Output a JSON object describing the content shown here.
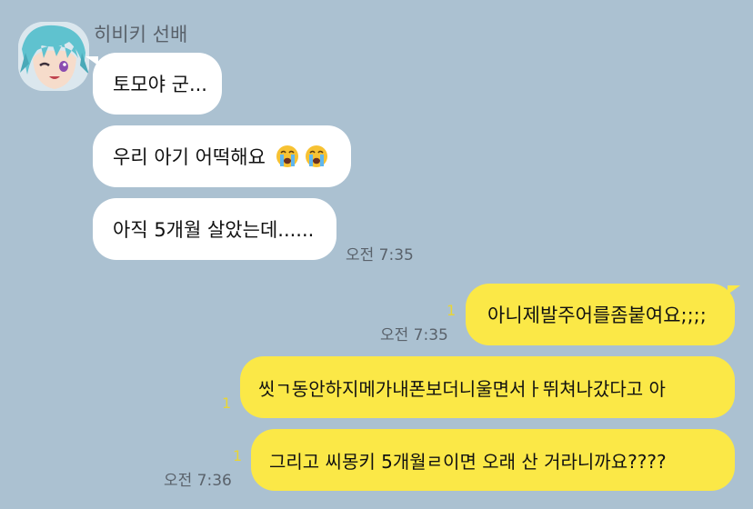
{
  "chat": {
    "sender_name": "히비키 선배",
    "incoming": [
      {
        "text": "토모야 군..."
      },
      {
        "text": "우리 아기 어떡해요 😭😭"
      },
      {
        "text": "아직 5개월 살았는데......"
      }
    ],
    "incoming_time": "오전 7:35",
    "outgoing": [
      {
        "text": "아니제발주어를좀붙여요;;;;",
        "unread": "1",
        "time": "오전 7:35"
      },
      {
        "text": "씻ㄱ동안하지메가내폰보더니울면서ㅏ뛰쳐나갔다고 아",
        "unread": "1",
        "time": ""
      },
      {
        "text": "그리고 씨몽키 5개월ㄹ이면 오래 산 거라니까요????",
        "unread": "1",
        "time": "오전 7:36"
      }
    ]
  },
  "colors": {
    "background": "#abc1d1",
    "incoming_bubble": "#ffffff",
    "outgoing_bubble": "#fbe847",
    "unread_count": "#e8d537"
  },
  "icons": {
    "avatar": "anime-character-avatar-icon",
    "emoji": "loudly-crying-face-icon"
  }
}
